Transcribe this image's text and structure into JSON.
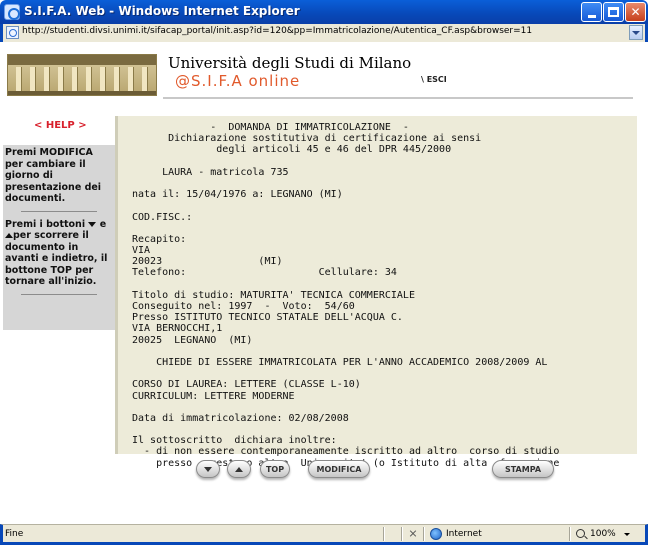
{
  "window": {
    "title": "S.I.F.A. Web - Windows Internet Explorer",
    "url": "http://studenti.divsi.unimi.it/sifacap_portal/init.asp?id=120&pp=Immatricolazione/Autentica_CF.asp&browser=11"
  },
  "header": {
    "university": "Università degli Studi di Milano",
    "portal": "@S.I.F.A  online",
    "logout_label": "\\ ESCI"
  },
  "sidebar": {
    "help_label": "< HELP >",
    "note1": "Premi MODIFICA per cambiare il giorno di presentazione dei documenti.",
    "note2_before": "Premi i bottoni",
    "note2_mid": "e",
    "note2_after": "per scorrere il documento in avanti e indietro, il bottone TOP per tornare all'inizio."
  },
  "document": {
    "lines": [
      "             -  DOMANDA DI IMMATRICOLAZIONE  -",
      "      Dichiarazione sostitutiva di certificazione ai sensi",
      "              degli articoli 45 e 46 del DPR 445/2000",
      "",
      "     LAURA - matricola 735",
      "",
      "nata il: 15/04/1976 a: LEGNANO (MI)",
      "",
      "COD.FISC.:",
      "",
      "Recapito:",
      "VIA",
      "20023                (MI)",
      "Telefono:                      Cellulare: 34",
      "",
      "Titolo di studio: MATURITA' TECNICA COMMERCIALE",
      "Conseguito nel: 1997  -  Voto:  54/60",
      "Presso ISTITUTO TECNICO STATALE DELL'ACQUA C.",
      "VIA BERNOCCHI,1",
      "20025  LEGNANO  (MI)",
      "",
      "    CHIEDE DI ESSERE IMMATRICOLATA PER L'ANNO ACCADEMICO 2008/2009 AL",
      "",
      "CORSO DI LAUREA: LETTERE (CLASSE L-10)",
      "CURRICULUM: LETTERE MODERNE",
      "",
      "Data di immatricolazione: 02/08/2008",
      "",
      "Il sottoscritto  dichiara inoltre:",
      "  - di non essere contemporaneamente iscritto ad altro  corso di studio",
      "    presso  questa o altra  Universita' (o Istituto di alta  formazione"
    ]
  },
  "buttons": {
    "down_icon": "arrow-down-icon",
    "up_icon": "arrow-up-icon",
    "top_label": "TOP",
    "modify_label": "MODIFICA",
    "print_label": "STAMPA"
  },
  "statusbar": {
    "status": "Fine",
    "zone": "Internet",
    "zoom": "100%"
  },
  "colors": {
    "titlebar": "#0848b8",
    "help": "#d8202c",
    "sifa": "#e15a2c",
    "doc_background": "#edebd9",
    "sidebar_background": "#d6d6d6"
  }
}
